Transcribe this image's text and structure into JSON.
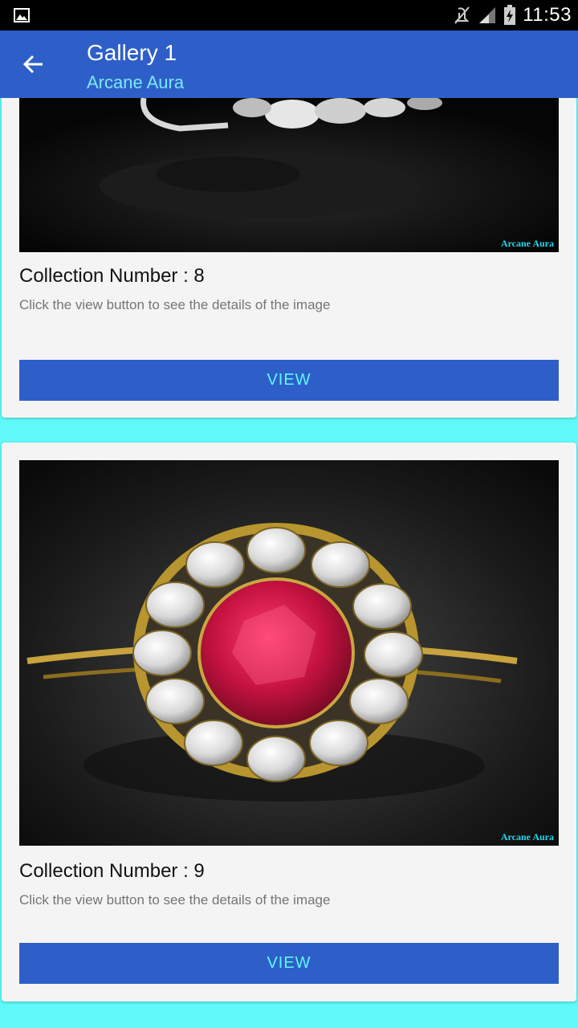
{
  "status_bar": {
    "time": "11:53",
    "icons": [
      "image-icon",
      "mute-icon",
      "signal-icon",
      "battery-charging-icon"
    ]
  },
  "app_bar": {
    "title": "Gallery 1",
    "subtitle": "Arcane Aura",
    "back_icon": "arrow-back-icon"
  },
  "cards": [
    {
      "heading": "Collection Number : 8",
      "description": "Click the view button to see the details of the image",
      "button_label": "VIEW",
      "watermark": "Arcane Aura"
    },
    {
      "heading": "Collection Number : 9",
      "description": "Click the view button to see the details of the image",
      "button_label": "VIEW",
      "watermark": "Arcane Aura"
    }
  ],
  "colors": {
    "app_bar": "#2e5fc9",
    "subtitle": "#7ae8f5",
    "background": "#5ff9f9",
    "button": "#2e5fc9",
    "button_text": "#5ff9f9"
  }
}
